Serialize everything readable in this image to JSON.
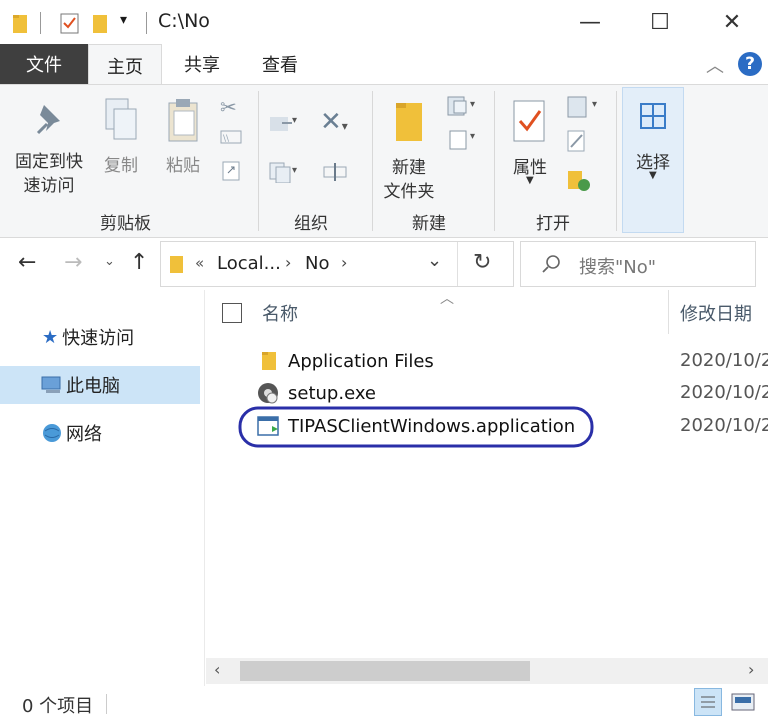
{
  "window": {
    "path": "C:\\No",
    "minimize": "—",
    "maximize": "☐",
    "close": "✕"
  },
  "tabs": {
    "file": "文件",
    "home": "主页",
    "share": "共享",
    "view": "查看"
  },
  "ribbon": {
    "pin_line1": "固定到快",
    "pin_line2": "速访问",
    "copy": "复制",
    "paste": "粘贴",
    "group_clipboard": "剪贴板",
    "group_organize": "组织",
    "new_folder_line1": "新建",
    "new_folder_line2": "文件夹",
    "group_new": "新建",
    "properties": "属性",
    "group_open": "打开",
    "select": "选择"
  },
  "address": {
    "prefix": "«",
    "crumb1": "Local...",
    "crumb2": "No",
    "search_placeholder": "搜索\"No\""
  },
  "nav": {
    "quick_access": "快速访问",
    "this_pc": "此电脑",
    "network": "网络"
  },
  "list": {
    "col_name": "名称",
    "col_date": "修改日期",
    "rows": [
      {
        "name": "Application Files",
        "date": "2020/10/2"
      },
      {
        "name": "setup.exe",
        "date": "2020/10/2"
      },
      {
        "name": "TIPASClientWindows.application",
        "date": "2020/10/2"
      }
    ]
  },
  "status": {
    "count": "0 个项目"
  },
  "colors": {
    "accent": "#2b6cc4",
    "highlight_ring": "#2a2fa8",
    "folder": "#f0c03a",
    "selected_nav": "#cce4f7"
  }
}
